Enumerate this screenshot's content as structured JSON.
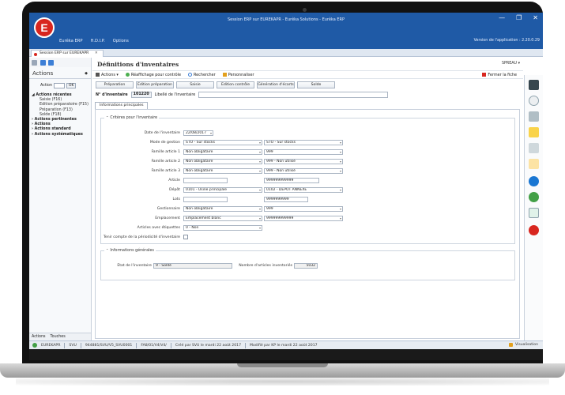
{
  "window": {
    "title": "Session ERP sur EUREKAPR - Eurêka Solutions - Eurêka ERP",
    "version": "Version de l'application : 2.20.0.29",
    "controls": {
      "minimize": "—",
      "maximize": "❐",
      "close": "✕"
    }
  },
  "menu": {
    "items": [
      "Eurêka ERP",
      "H.D.I.P.",
      "Options"
    ]
  },
  "doc_tab": {
    "label": "Session ERP sur EUREKAPR",
    "close": "✕"
  },
  "left": {
    "header": "Actions",
    "action_label": "Action",
    "ok": "OK",
    "tree": [
      {
        "label": "Actions récentes",
        "type": "group",
        "caret": "◢"
      },
      {
        "label": "Saisie (F16)",
        "type": "leaf"
      },
      {
        "label": "Edition préparatoire (F15)",
        "type": "leaf"
      },
      {
        "label": "Préparation (F13)",
        "type": "leaf"
      },
      {
        "label": "Solde (F18)",
        "type": "leaf"
      },
      {
        "label": "Actions pertinentes",
        "type": "group",
        "caret": "›"
      },
      {
        "label": "Actions",
        "type": "group",
        "caret": "›"
      },
      {
        "label": "Actions standard",
        "type": "group",
        "caret": "›"
      },
      {
        "label": "Actions systématiques",
        "type": "group",
        "caret": "›"
      }
    ],
    "bottom_tabs": [
      "Actions",
      "Touches"
    ]
  },
  "main": {
    "title": "Définitions d'inventaires",
    "user": "SPREAU ▾",
    "action_bar": {
      "actions": "Actions",
      "refresh": "Réaffichage pour contrôle",
      "search": "Rechercher",
      "customize": "Personnaliser",
      "close": "Fermer la fiche"
    },
    "phases": [
      "Préparation",
      "Edition préparation",
      "Saisie",
      "Edition contrôle",
      "Génération d'écarts",
      "Solde"
    ],
    "inventory": {
      "label": "N° d'inventaire",
      "number": "101220",
      "libelle_label": "Libellé de l'inventaire"
    },
    "tab": "Informations principales",
    "criteria": {
      "title": "Critères pour l'inventaire",
      "date_label": "Date de l'inventaire",
      "date": "22/08/2017",
      "mode_label": "Mode de gestion",
      "mode_1": "STO - Sur stocks",
      "mode_2": "STO - Sur stocks",
      "fam1_label": "Famille article 1",
      "fam1_a": "Non obligataire",
      "fam1_b": "999",
      "fam2_label": "Famille article 2",
      "fam2_a": "Non obligataire",
      "fam2_b": "999 - Non utilisé",
      "fam3_label": "Famille article 3",
      "fam3_a": "Non obligataire",
      "fam3_b": "999 - Non utilisé",
      "article_label": "Article",
      "article_b": "999999999999",
      "depot_label": "Dépôt",
      "depot_a": "0101 - Usine principale",
      "depot_b": "0102 - DEPOT ANNEXE",
      "lots_label": "Lots",
      "lots_b": "9999999999",
      "gest_label": "Gestionnaire",
      "gest_a": "Non obligataire",
      "gest_b": "999",
      "empl_label": "Emplacement",
      "empl_a": "Emplacement blanc",
      "empl_b": "999999999999",
      "etiq_label": "Articles avec étiquettes",
      "etiq_a": "0 - Non",
      "period_label": "Tenir compte de la périodicité d'inventaire"
    },
    "general": {
      "title": "Informations générales",
      "state_label": "Etat de l'inventaire",
      "state": "9 - Soldé",
      "count_label": "Nombre d'articles inventoriés",
      "count": "5032"
    },
    "status_message": "Aucun message à afficher"
  },
  "statusbar": {
    "items": [
      "EUREKAPR",
      "SVU",
      "944881/SVU/V5_SVU0001",
      "FA8/01/V4/V4/",
      "Créé par SVU le mardi 22 août 2017",
      "Modifié par KP le mardi 22 août 2017"
    ],
    "right": "Visualisation"
  },
  "colors": {
    "brand_blue": "#1f5aa6",
    "brand_red": "#d8261f",
    "status_green": "#43a047"
  }
}
